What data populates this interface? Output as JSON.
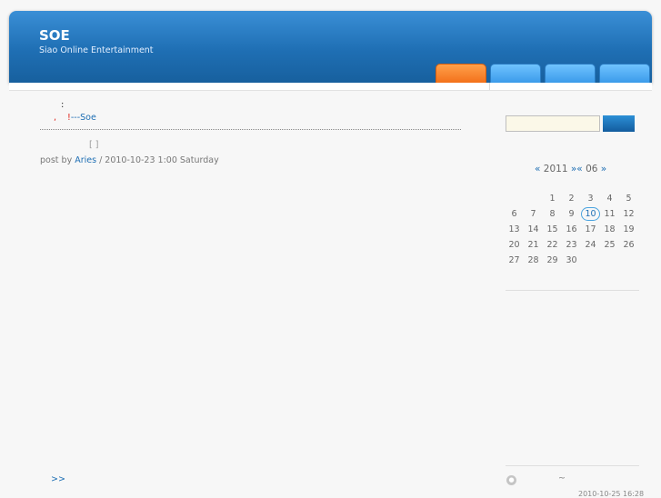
{
  "header": {
    "title": "SOE",
    "subtitle": "Siao Online Entertainment",
    "colors": {
      "header": "#1f6fb4",
      "active_tab": "#f3711b",
      "tab": "#3b9bea"
    }
  },
  "post": {
    "line1": ":",
    "line2_comma": ",",
    "line2_exclaim": "!",
    "line2_signature": "---Soe",
    "brackets": "[ ]",
    "meta_prefix": "post by ",
    "author": "Aries",
    "meta_suffix": " / 2010-10-23 1:00 Saturday"
  },
  "calendar": {
    "prev": "«",
    "year": "2011",
    "mid": "»«",
    "month": "06",
    "next": "»",
    "today": "10",
    "rows": [
      [
        "",
        "",
        "1",
        "2",
        "3",
        "4",
        "5"
      ],
      [
        "6",
        "7",
        "8",
        "9",
        "10",
        "11",
        "12"
      ],
      [
        "13",
        "14",
        "15",
        "16",
        "17",
        "18",
        "19"
      ],
      [
        "20",
        "21",
        "22",
        "23",
        "24",
        "25",
        "26"
      ],
      [
        "27",
        "28",
        "29",
        "30",
        "",
        "",
        ""
      ]
    ]
  },
  "footer": {
    "more_link": ">>",
    "recent_tilde": "~",
    "recent_time": "2010-10-25 16:28"
  }
}
